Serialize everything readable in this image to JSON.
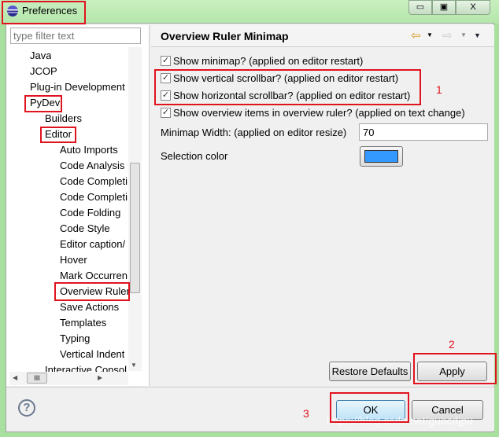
{
  "window": {
    "title": "Preferences",
    "minimize": "▭",
    "maximize": "▣",
    "close": "X"
  },
  "sidebar": {
    "filter_placeholder": "type filter text",
    "items": [
      {
        "label": "Java",
        "level": 1
      },
      {
        "label": "JCOP",
        "level": 1
      },
      {
        "label": "Plug-in Development",
        "level": 1
      },
      {
        "label": "PyDev",
        "level": 1
      },
      {
        "label": "Builders",
        "level": 2
      },
      {
        "label": "Editor",
        "level": 2
      },
      {
        "label": "Auto Imports",
        "level": 3
      },
      {
        "label": "Code Analysis",
        "level": 3
      },
      {
        "label": "Code Completi",
        "level": 3
      },
      {
        "label": "Code Completi",
        "level": 3
      },
      {
        "label": "Code Folding",
        "level": 3
      },
      {
        "label": "Code Style",
        "level": 3
      },
      {
        "label": "Editor caption/",
        "level": 3
      },
      {
        "label": "Hover",
        "level": 3
      },
      {
        "label": "Mark Occurren",
        "level": 3
      },
      {
        "label": "Overview Ruler",
        "level": 3,
        "selected": true
      },
      {
        "label": "Save Actions",
        "level": 3
      },
      {
        "label": "Templates",
        "level": 3
      },
      {
        "label": "Typing",
        "level": 3
      },
      {
        "label": "Vertical Indent",
        "level": 3
      },
      {
        "label": "Interactive Consol",
        "level": 2
      }
    ],
    "hscroll_grip": "III"
  },
  "page": {
    "title": "Overview Ruler Minimap",
    "options": [
      {
        "label": "Show minimap? (applied on editor restart)",
        "checked": true
      },
      {
        "label": "Show vertical scrollbar? (applied on editor restart)",
        "checked": true
      },
      {
        "label": "Show horizontal scrollbar? (applied on editor restart)",
        "checked": true
      },
      {
        "label": "Show overview items in overview ruler? (applied on text change)",
        "checked": true
      }
    ],
    "minimap_width_label": "Minimap Width: (applied on editor resize)",
    "minimap_width_value": "70",
    "selection_color_label": "Selection color",
    "selection_color": "#3399ff",
    "restore_defaults": "Restore Defaults",
    "apply": "Apply"
  },
  "footer": {
    "help": "?",
    "ok": "OK",
    "cancel": "Cancel"
  },
  "annotations": {
    "n1": "1",
    "n2": "2",
    "n3": "3"
  },
  "watermark": "https://blog.csdn.net/guocdjpu"
}
